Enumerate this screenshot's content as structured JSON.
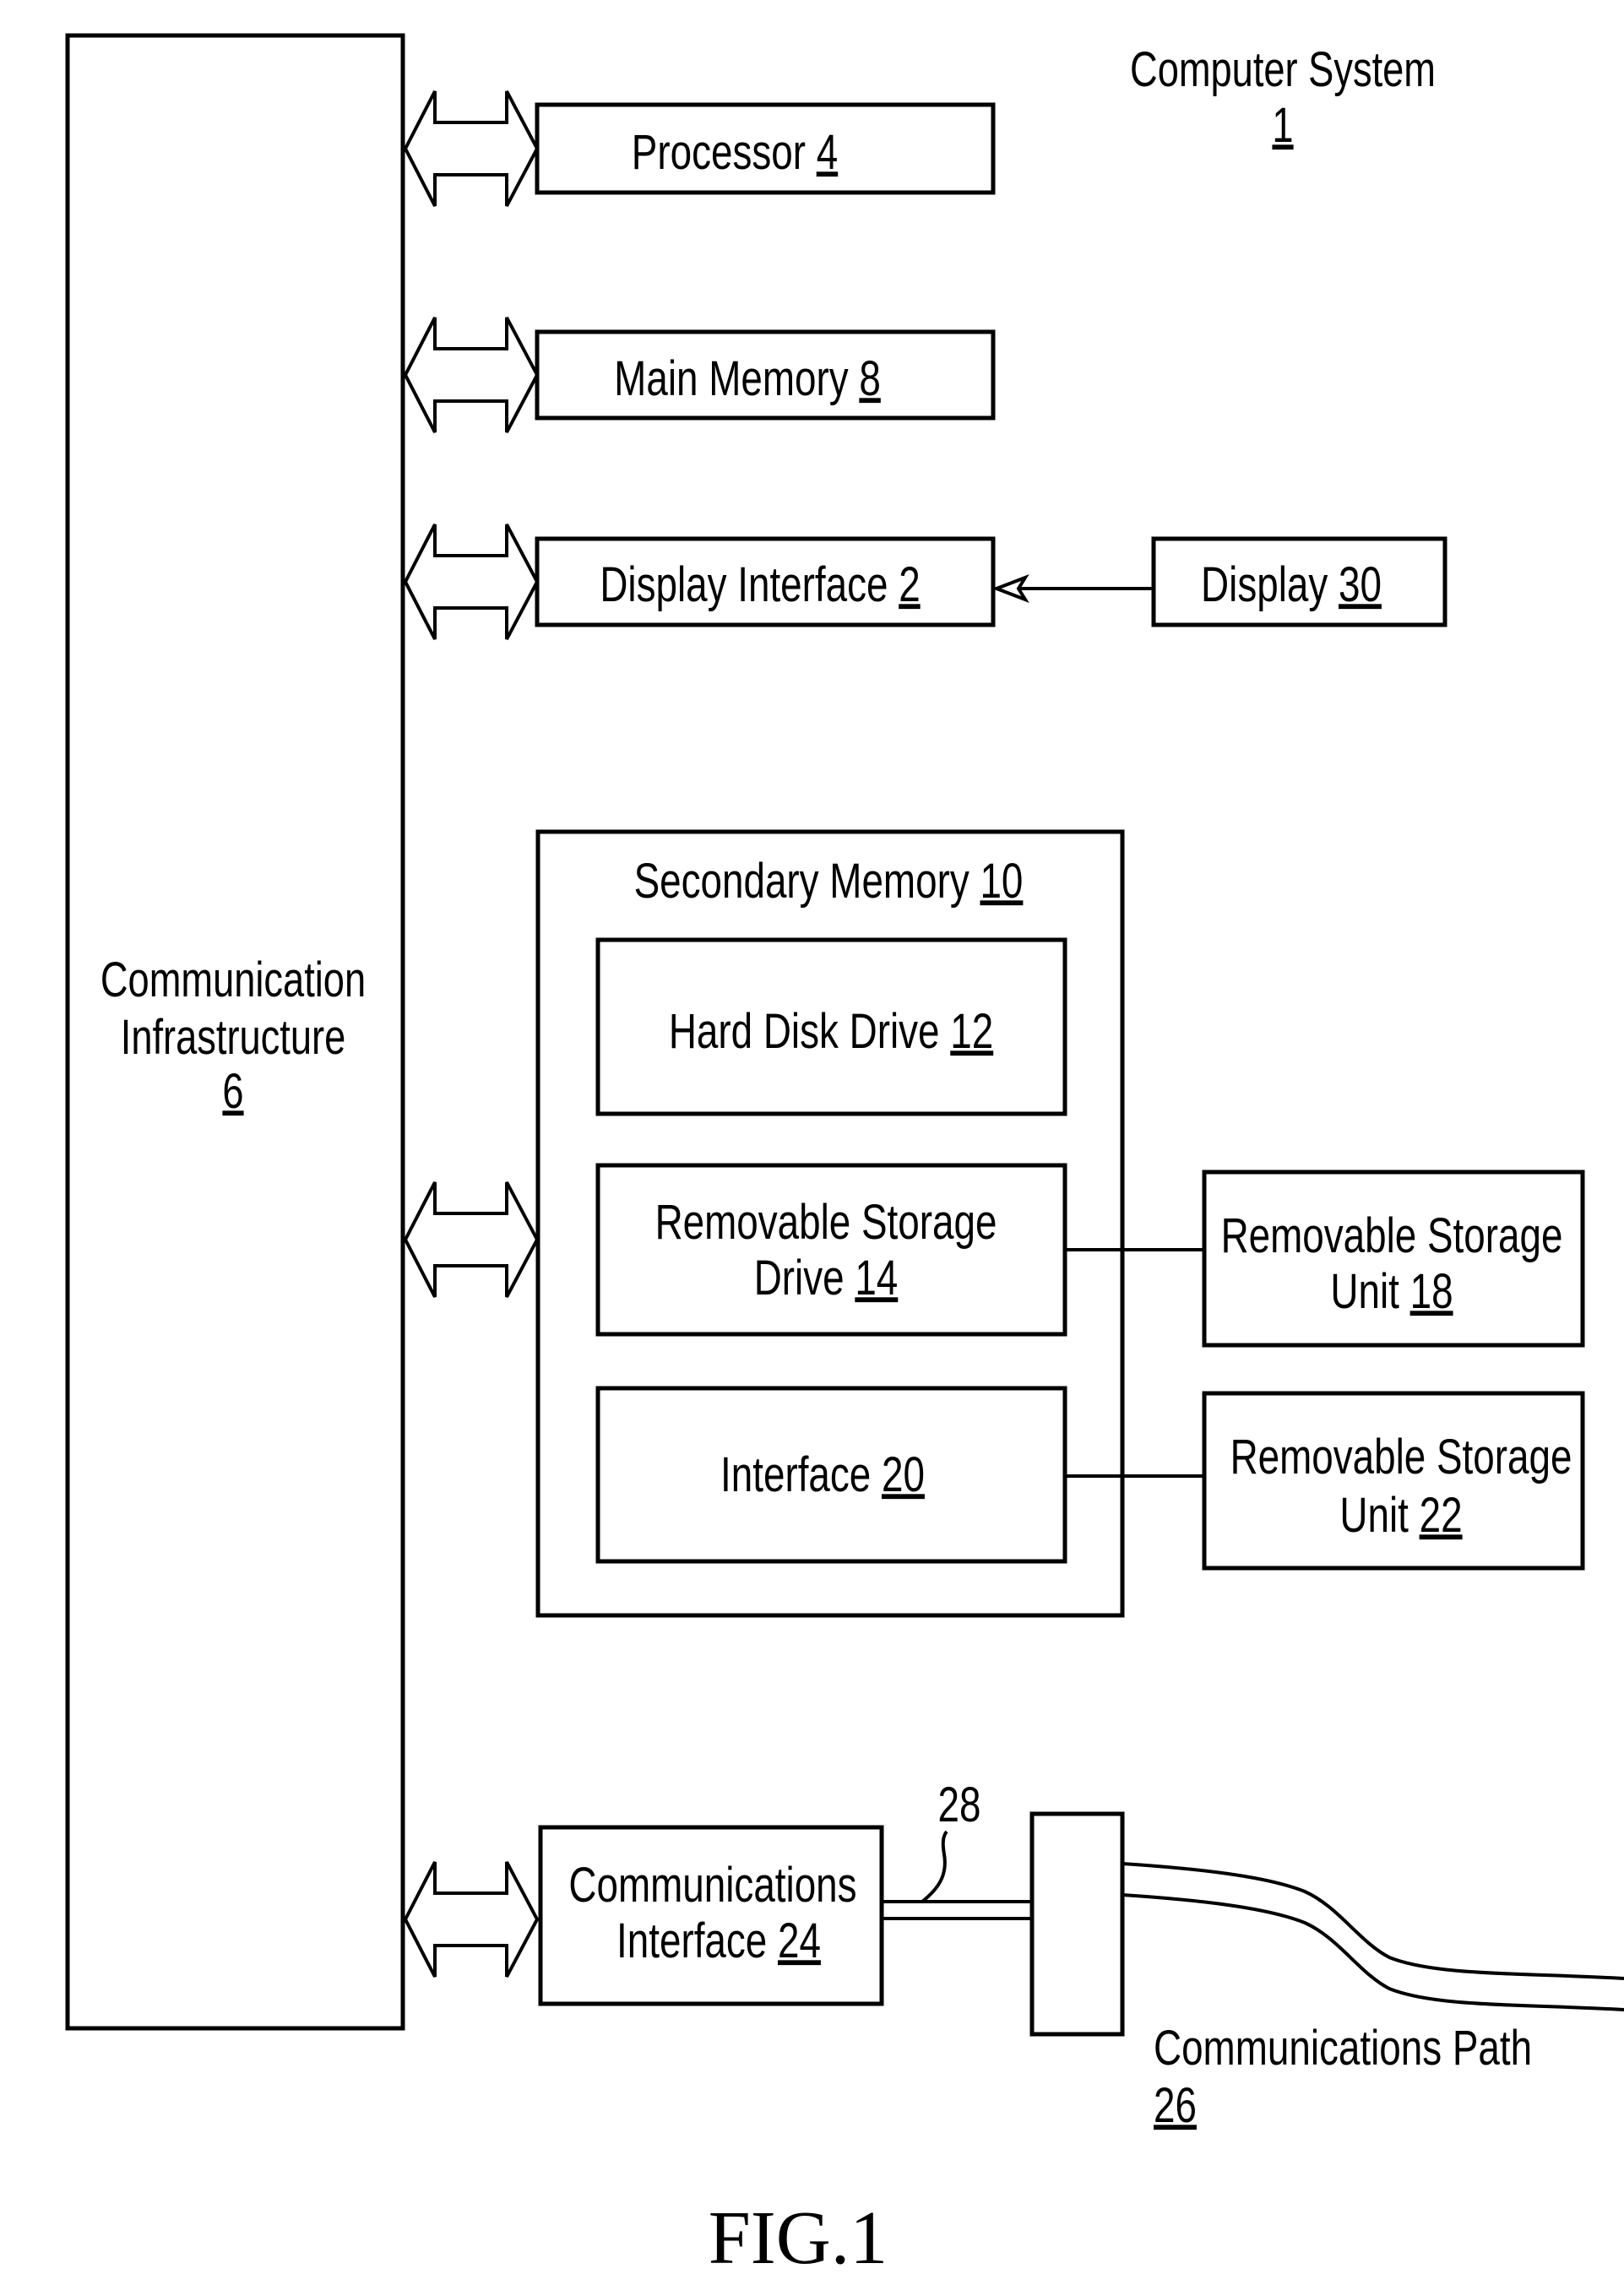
{
  "figure": {
    "caption": "FIG.1",
    "colors": {
      "ink": "#000000",
      "paper": "#ffffff"
    }
  },
  "system": {
    "name": "Computer System",
    "ref": "1"
  },
  "infrastructure": {
    "line1": "Communication",
    "line2": "Infrastructure",
    "ref": "6"
  },
  "processor": {
    "name": "Processor ",
    "ref": "4"
  },
  "main_memory": {
    "name": "Main Memory ",
    "ref": "8"
  },
  "display_interface": {
    "name": "Display Interface ",
    "ref": "2"
  },
  "display": {
    "name": "Display ",
    "ref": "30"
  },
  "secondary_memory": {
    "name": "Secondary Memory ",
    "ref": "10"
  },
  "hard_disk": {
    "name": "Hard Disk Drive ",
    "ref": "12"
  },
  "removable_drive": {
    "line1": "Removable Storage",
    "line2": "Drive ",
    "ref": "14"
  },
  "interface": {
    "name": "Interface ",
    "ref": "20"
  },
  "removable_unit_18": {
    "line1": "Removable Storage",
    "line2": "Unit ",
    "ref": "18"
  },
  "removable_unit_22": {
    "line1": "Removable Storage",
    "line2": "Unit ",
    "ref": "22"
  },
  "comm_interface": {
    "line1": "Communications",
    "line2": "Interface ",
    "ref": "24"
  },
  "channel": {
    "ref": "28"
  },
  "comm_path": {
    "name": "Communications Path",
    "ref": "26"
  }
}
